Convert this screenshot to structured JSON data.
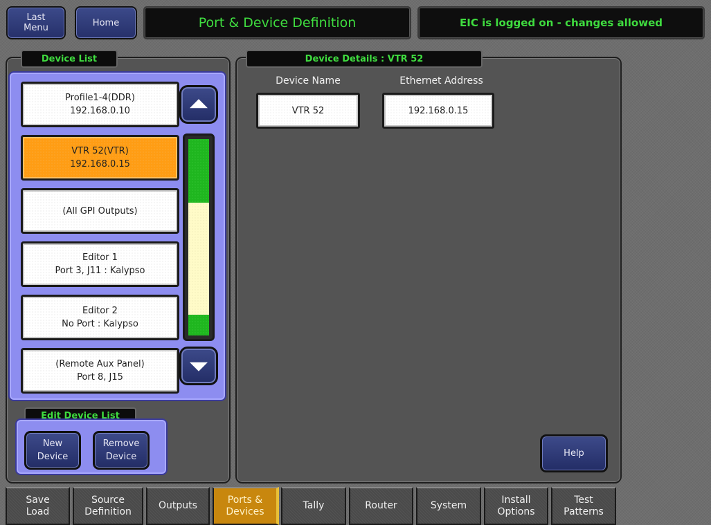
{
  "header": {
    "last_menu": [
      "Last",
      "Menu"
    ],
    "home": "Home",
    "title": "Port & Device Definition",
    "status": "EIC is logged on - changes allowed"
  },
  "device_list": {
    "label": "Device List",
    "items": [
      {
        "line1": "Profile1-4(DDR)",
        "line2": "192.168.0.10",
        "selected": false
      },
      {
        "line1": "VTR 52(VTR)",
        "line2": "192.168.0.15",
        "selected": true
      },
      {
        "line1": "(All GPI Outputs)",
        "line2": "",
        "selected": false
      },
      {
        "line1": "Editor 1",
        "line2": "Port 3, J11 : Kalypso",
        "selected": false
      },
      {
        "line1": "Editor 2",
        "line2": "No Port : Kalypso",
        "selected": false
      },
      {
        "line1": "(Remote Aux Panel)",
        "line2": "Port 8, J15",
        "selected": false
      }
    ],
    "scroll_up_icon": "triangle-up-icon",
    "scroll_down_icon": "triangle-down-icon"
  },
  "edit_device_list": {
    "label": "Edit Device List",
    "new_device": [
      "New",
      "Device"
    ],
    "remove_device": [
      "Remove",
      "Device"
    ]
  },
  "device_details": {
    "label": "Device Details : VTR 52",
    "device_name_label": "Device Name",
    "device_name_value": "VTR 52",
    "ethernet_label": "Ethernet Address",
    "ethernet_value": "192.168.0.15",
    "help": "Help"
  },
  "tabs": [
    {
      "l1": "Save",
      "l2": "Load",
      "active": false
    },
    {
      "l1": "Source",
      "l2": "Definition",
      "active": false
    },
    {
      "l1": "Outputs",
      "l2": "",
      "active": false
    },
    {
      "l1": "Ports &",
      "l2": "Devices",
      "active": true
    },
    {
      "l1": "Tally",
      "l2": "",
      "active": false
    },
    {
      "l1": "Router",
      "l2": "",
      "active": false
    },
    {
      "l1": "System",
      "l2": "",
      "active": false
    },
    {
      "l1": "Install",
      "l2": "Options",
      "active": false
    },
    {
      "l1": "Test",
      "l2": "Patterns",
      "active": false
    }
  ],
  "colors": {
    "accent_green": "#3fdc3f",
    "selected_orange": "#ff9d14",
    "button_blue": "#2f3a7a",
    "list_frame_purple": "#8d8df0"
  }
}
